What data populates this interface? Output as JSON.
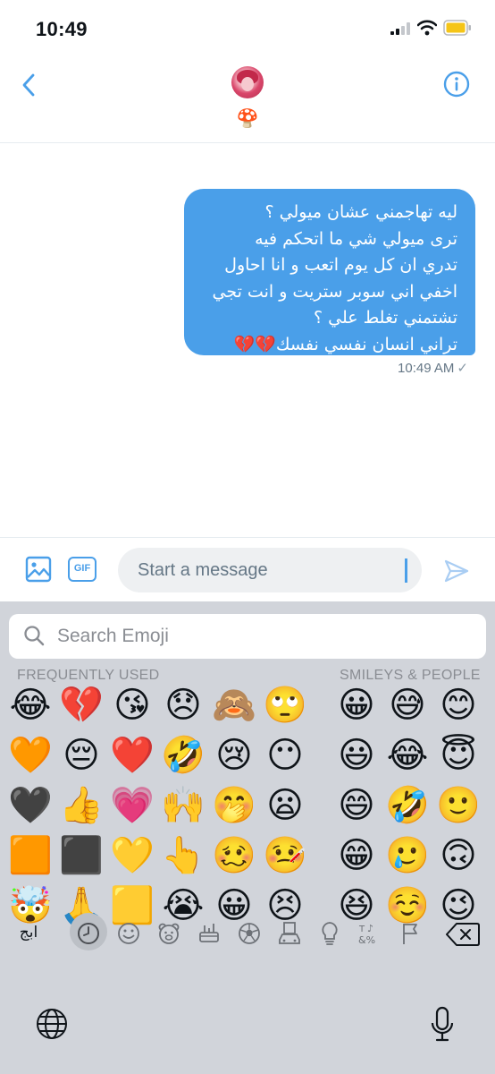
{
  "status_bar": {
    "time": "10:49"
  },
  "header": {
    "contact_name": "🍄"
  },
  "message": {
    "lines": [
      "ليه تهاجمني عشان ميولي ؟",
      "ترى ميولي شي ما اتحكم فيه",
      "تدري ان كل يوم اتعب و انا احاول",
      "اخفي اني سوبر ستريت و انت تجي",
      "تشتمني تغلط علي ؟",
      "تراني انسان نفسي نفسك💔💔"
    ],
    "time": "10:49 AM",
    "status_mark": "✓"
  },
  "composer": {
    "placeholder": "Start a message",
    "gif_label": "GIF"
  },
  "keyboard": {
    "search_placeholder": "Search Emoji",
    "section_frequent": "FREQUENTLY USED",
    "section_smileys": "SMILEYS & PEOPLE",
    "abc_label": "ابج",
    "frequent_emoji": [
      [
        "😂",
        "💔",
        "😘",
        "😞",
        "🙈",
        "🙄"
      ],
      [
        "🧡",
        "😔",
        "❤️",
        "🤣",
        "😢",
        "😶"
      ],
      [
        "🖤",
        "👍",
        "💗",
        "🙌",
        "🤭",
        "😦"
      ],
      [
        "🟧",
        "⬛",
        "💛",
        "👆",
        "🥴",
        "🤒"
      ],
      [
        "🤯",
        "🙏",
        "🟨",
        "😭",
        "😀",
        "😣"
      ]
    ],
    "smiley_emoji": [
      [
        "😀",
        "😅",
        "😊"
      ],
      [
        "😃",
        "😂",
        "😇"
      ],
      [
        "😄",
        "🤣",
        "🙂"
      ],
      [
        "😁",
        "🥲",
        "🙃"
      ],
      [
        "😆",
        "☺️",
        "😉"
      ]
    ],
    "categories": [
      "recent",
      "smileys",
      "animals",
      "food",
      "activity",
      "travel",
      "objects",
      "symbols",
      "flags"
    ]
  }
}
